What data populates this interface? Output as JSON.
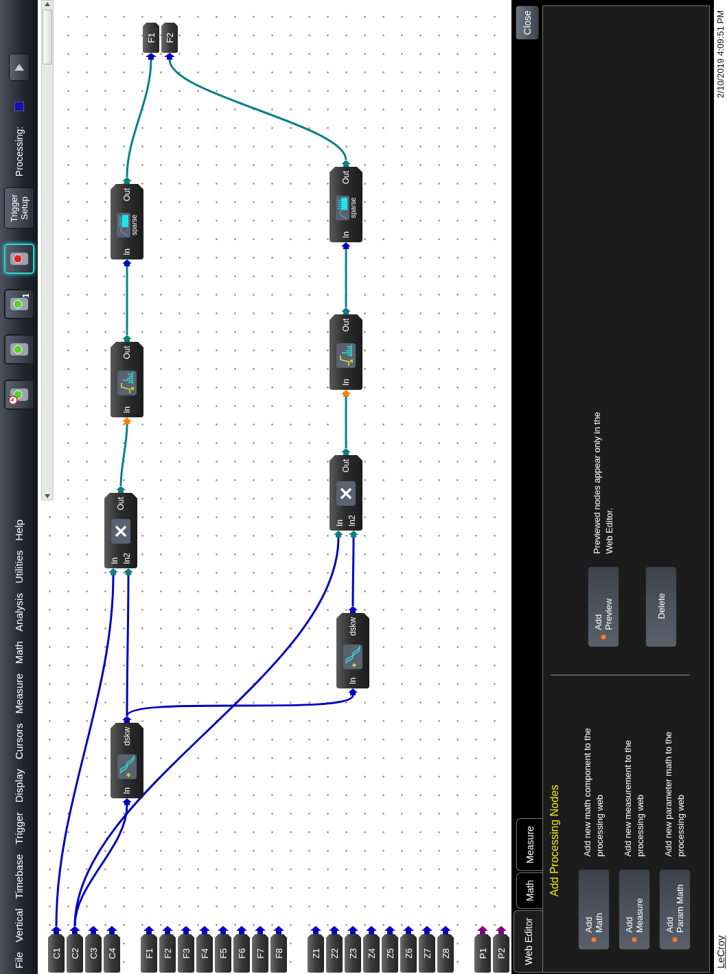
{
  "menu": [
    "File",
    "Vertical",
    "Timebase",
    "Trigger",
    "Display",
    "Cursors",
    "Measure",
    "Math",
    "Analysis",
    "Utilities",
    "Help"
  ],
  "trigger_modes": [
    {
      "kind": "auto",
      "selected": false
    },
    {
      "kind": "normal",
      "selected": false
    },
    {
      "kind": "single",
      "badge": "1",
      "selected": false
    },
    {
      "kind": "stop",
      "selected": true
    }
  ],
  "trigger_setup": [
    "Trigger",
    "Setup"
  ],
  "processing": {
    "label": "Processing:"
  },
  "source_groups": [
    {
      "items": [
        {
          "label": "C1",
          "color": "#0000c0"
        },
        {
          "label": "C2",
          "color": "#0000c0"
        },
        {
          "label": "C3",
          "color": "#0000c0"
        },
        {
          "label": "C4",
          "color": "#0000c0"
        }
      ]
    },
    {
      "items": [
        {
          "label": "F1",
          "color": "#0000c0"
        },
        {
          "label": "F2",
          "color": "#0000c0"
        },
        {
          "label": "F3",
          "color": "#0000c0"
        },
        {
          "label": "F4",
          "color": "#0000c0"
        },
        {
          "label": "F5",
          "color": "#0000c0"
        },
        {
          "label": "F6",
          "color": "#0000c0"
        },
        {
          "label": "F7",
          "color": "#0000c0"
        },
        {
          "label": "F8",
          "color": "#0000c0"
        }
      ]
    },
    {
      "items": [
        {
          "label": "Z1",
          "color": "#0000c0"
        },
        {
          "label": "Z2",
          "color": "#0000c0"
        },
        {
          "label": "Z3",
          "color": "#0000c0"
        },
        {
          "label": "Z4",
          "color": "#0000c0"
        },
        {
          "label": "Z5",
          "color": "#0000c0"
        },
        {
          "label": "Z6",
          "color": "#0000c0"
        },
        {
          "label": "Z7",
          "color": "#0000c0"
        },
        {
          "label": "Z8",
          "color": "#0000c0"
        }
      ]
    },
    {
      "items": [
        {
          "label": "P1",
          "color": "#800080"
        },
        {
          "label": "P2",
          "color": "#800080"
        }
      ]
    }
  ],
  "nodes": [
    {
      "kind": "deskew",
      "inputs": [
        {
          "label": "In",
          "color": "#0000c0"
        }
      ],
      "output": {
        "label": "dskw",
        "color": "#0000c0"
      }
    },
    {
      "kind": "multiply",
      "inputs": [
        {
          "label": "In",
          "color": "#0a8080"
        },
        {
          "label": "In2",
          "color": "#0a8080"
        }
      ],
      "output": {
        "label": "Out",
        "color": "#0a8080"
      }
    },
    {
      "kind": "spectrum",
      "inputs": [
        {
          "label": "In",
          "color": "#ff8000"
        }
      ],
      "output": {
        "label": "Out",
        "color": "#0a8080"
      }
    },
    {
      "kind": "sparse",
      "caption": "sparse",
      "inputs": [
        {
          "label": "In",
          "color": "#0000c0"
        }
      ],
      "output": {
        "label": "Out",
        "color": "#0a8080"
      }
    },
    {
      "kind": "deskew",
      "inputs": [
        {
          "label": "In",
          "color": "#0000c0"
        }
      ],
      "output": {
        "label": "dskw",
        "color": "#0000c0"
      }
    },
    {
      "kind": "multiply",
      "inputs": [
        {
          "label": "In",
          "color": "#0a8080"
        },
        {
          "label": "In2",
          "color": "#0a8080"
        }
      ],
      "output": {
        "label": "Out",
        "color": "#0a8080"
      }
    },
    {
      "kind": "spectrum",
      "inputs": [
        {
          "label": "In",
          "color": "#ff8000"
        }
      ],
      "output": {
        "label": "Out",
        "color": "#0a8080"
      }
    },
    {
      "kind": "sparse",
      "caption": "sparse",
      "inputs": [
        {
          "label": "In",
          "color": "#0000c0"
        }
      ],
      "output": {
        "label": "Out",
        "color": "#0a8080"
      }
    }
  ],
  "outputs": [
    {
      "label": "F1",
      "color": "#0000c0"
    },
    {
      "label": "F2",
      "color": "#0000c0"
    }
  ],
  "panel": {
    "tabs": [
      {
        "label": "Web Editor",
        "selected": true
      },
      {
        "label": "Math",
        "selected": false
      },
      {
        "label": "Measure",
        "selected": false
      }
    ],
    "close_button": "Close",
    "heading": "Add Processing Nodes",
    "add_actions": [
      {
        "button": [
          "Add",
          "Math"
        ],
        "description": "Add new math component to the processing web"
      },
      {
        "button": [
          "Add",
          "Measure"
        ],
        "description": "Add new measurement to the processing web"
      },
      {
        "button": [
          "Add",
          "Param Math"
        ],
        "description": "Add new parameter math to the processing web"
      }
    ],
    "preview_button": [
      "Add",
      "Preview"
    ],
    "preview_note": "Previewed nodes appear only in the Web Editor.",
    "delete_button": "Delete"
  },
  "footer": {
    "brand": "LeCroy",
    "timestamp": "2/10/2019 4:09:51 PM"
  }
}
